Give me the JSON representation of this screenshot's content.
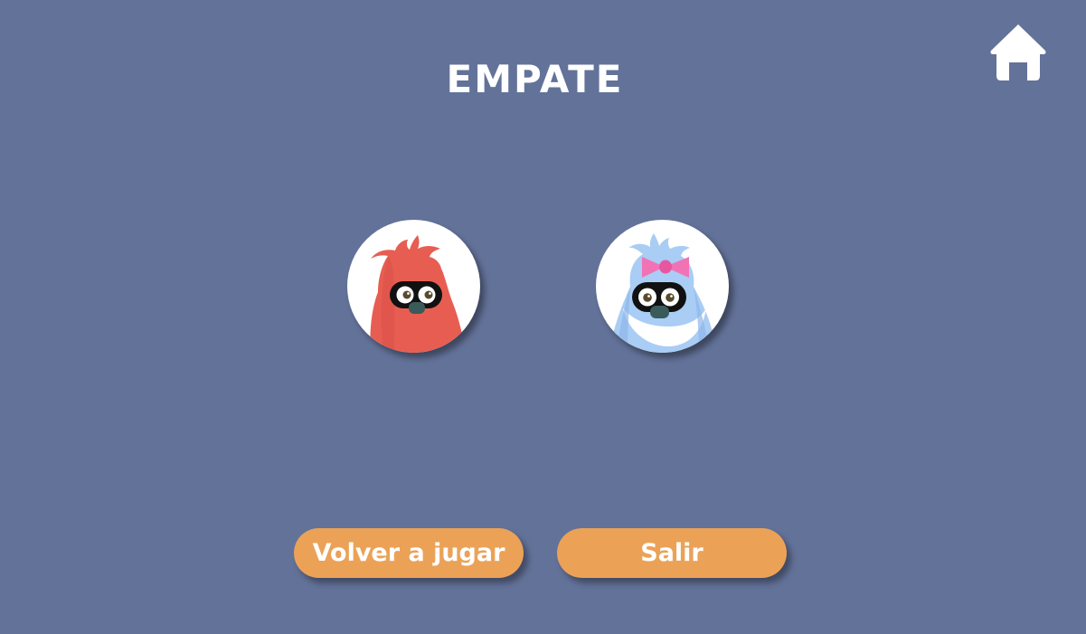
{
  "header": {
    "title": "EMPATE",
    "home_icon": "home-icon"
  },
  "players": [
    {
      "avatar_icon": "red-monster-avatar-icon"
    },
    {
      "avatar_icon": "blue-monster-with-pink-bow-avatar-icon"
    }
  ],
  "actions": {
    "play_again_label": "Volver a jugar",
    "exit_label": "Salir"
  },
  "colors": {
    "background": "#637299",
    "button": "#eba257",
    "text": "#ffffff",
    "red_monster": "#e85d52",
    "blue_monster": "#a9cdf4",
    "bow": "#f173b6"
  }
}
